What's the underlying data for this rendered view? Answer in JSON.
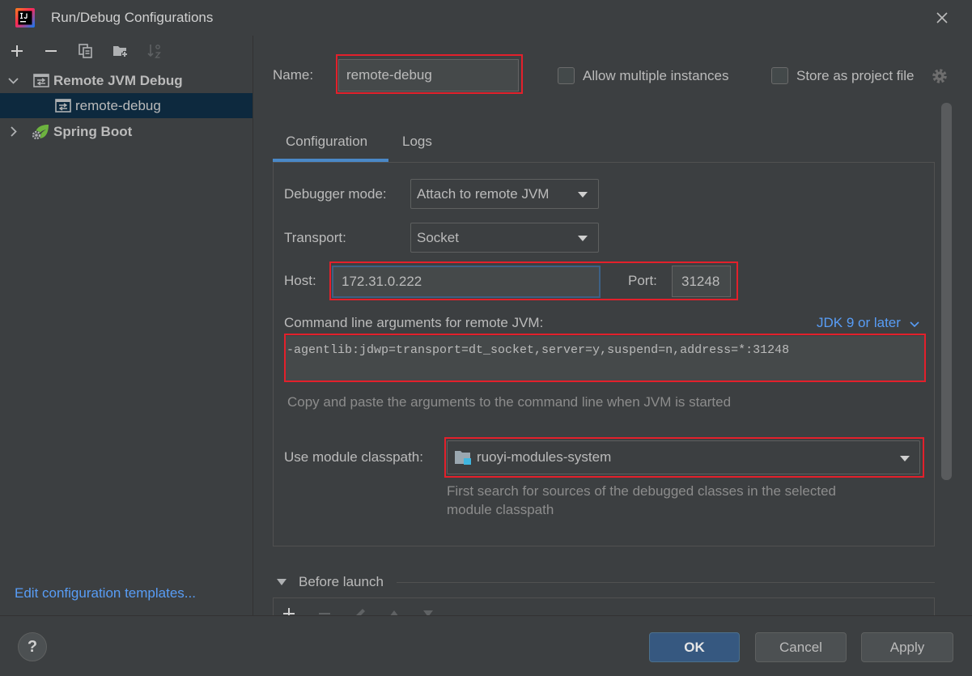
{
  "window": {
    "title": "Run/Debug Configurations",
    "app_icon": "intellij-idea-icon",
    "close_icon": "close-icon"
  },
  "sidebar": {
    "toolbar_icons": [
      "add-icon",
      "remove-icon",
      "copy-icon",
      "new-folder-icon",
      "sort-icon"
    ],
    "tree": [
      {
        "label": "Remote JVM Debug",
        "expanded": true,
        "icon": "remote-jvm-debug-icon",
        "children": [
          {
            "label": "remote-debug",
            "selected": true,
            "icon": "remote-jvm-debug-icon"
          }
        ]
      },
      {
        "label": "Spring Boot",
        "expanded": false,
        "icon": "spring-boot-icon"
      }
    ],
    "templates_link": "Edit configuration templates..."
  },
  "header": {
    "name_label": "Name:",
    "name_value": "remote-debug",
    "checkboxes": [
      {
        "label": "Allow multiple instances",
        "checked": false
      },
      {
        "label": "Store as project file",
        "checked": false
      }
    ],
    "settings_icon": "gear-icon"
  },
  "tabs": [
    {
      "label": "Configuration",
      "active": true
    },
    {
      "label": "Logs",
      "active": false
    }
  ],
  "configuration": {
    "debugger_mode": {
      "label": "Debugger mode:",
      "value": "Attach to remote JVM"
    },
    "transport": {
      "label": "Transport:",
      "value": "Socket"
    },
    "host": {
      "label": "Host:",
      "value": "172.31.0.222"
    },
    "port": {
      "label": "Port:",
      "value": "31248"
    },
    "command_line": {
      "label": "Command line arguments for remote JVM:",
      "jdk_selector": "JDK 9 or later",
      "value": "-agentlib:jdwp=transport=dt_socket,server=y,suspend=n,address=*:31248",
      "hint": "Copy and paste the arguments to the command line when JVM is started"
    },
    "module_classpath": {
      "label": "Use module classpath:",
      "value": "ruoyi-modules-system",
      "icon": "module-folder-icon",
      "hint_lines": [
        "First search for sources of the debugged classes in the selected",
        "module classpath"
      ]
    }
  },
  "before_launch": {
    "label": "Before launch",
    "expanded": true,
    "toolbar_icons": [
      "add-icon",
      "remove-icon",
      "edit-icon",
      "move-up-icon",
      "move-down-icon"
    ]
  },
  "footer": {
    "help_label": "?",
    "buttons": {
      "ok": "OK",
      "cancel": "Cancel",
      "apply": "Apply"
    }
  },
  "colors": {
    "background": "#3c3f41",
    "text": "#bbbbbb",
    "link": "#589df6",
    "accent": "#4a88c7",
    "selection": "#0d293e",
    "primary_button": "#365880",
    "hint_text": "#8c8c8c",
    "annotation": "#e3202b"
  }
}
